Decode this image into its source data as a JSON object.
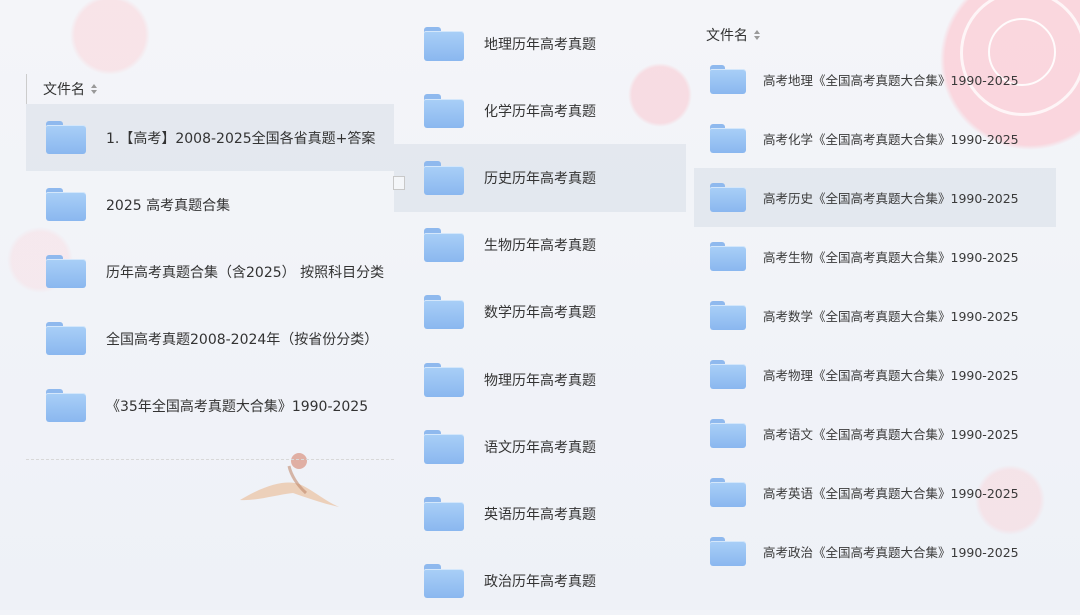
{
  "left_panel": {
    "header": "文件名",
    "items": [
      {
        "label": "1.【高考】2008-2025全国各省真题+答案"
      },
      {
        "label": "2025 高考真题合集"
      },
      {
        "label": "历年高考真题合集（含2025） 按照科目分类"
      },
      {
        "label": "全国高考真题2008-2024年（按省份分类）"
      },
      {
        "label": "《35年全国高考真题大合集》1990-2025"
      }
    ]
  },
  "middle_panel": {
    "items": [
      {
        "label": "地理历年高考真题"
      },
      {
        "label": "化学历年高考真题"
      },
      {
        "label": "历史历年高考真题"
      },
      {
        "label": "生物历年高考真题"
      },
      {
        "label": "数学历年高考真题"
      },
      {
        "label": "物理历年高考真题"
      },
      {
        "label": "语文历年高考真题"
      },
      {
        "label": "英语历年高考真题"
      },
      {
        "label": "政治历年高考真题"
      }
    ]
  },
  "right_panel": {
    "header": "文件名",
    "items": [
      {
        "label": "高考地理《全国高考真题大合集》1990-2025"
      },
      {
        "label": "高考化学《全国高考真题大合集》1990-2025"
      },
      {
        "label": "高考历史《全国高考真题大合集》1990-2025"
      },
      {
        "label": "高考生物《全国高考真题大合集》1990-2025"
      },
      {
        "label": "高考数学《全国高考真题大合集》1990-2025"
      },
      {
        "label": "高考物理《全国高考真题大合集》1990-2025"
      },
      {
        "label": "高考语文《全国高考真题大合集》1990-2025"
      },
      {
        "label": "高考英语《全国高考真题大合集》1990-2025"
      },
      {
        "label": "高考政治《全国高考真题大合集》1990-2025"
      }
    ]
  },
  "colors": {
    "folder": "#9cc3f4",
    "selected_row": "#e1e5ed",
    "text": "#333333"
  },
  "icons": {
    "folder": "folder-icon",
    "sort": "sort-arrows-icon"
  }
}
